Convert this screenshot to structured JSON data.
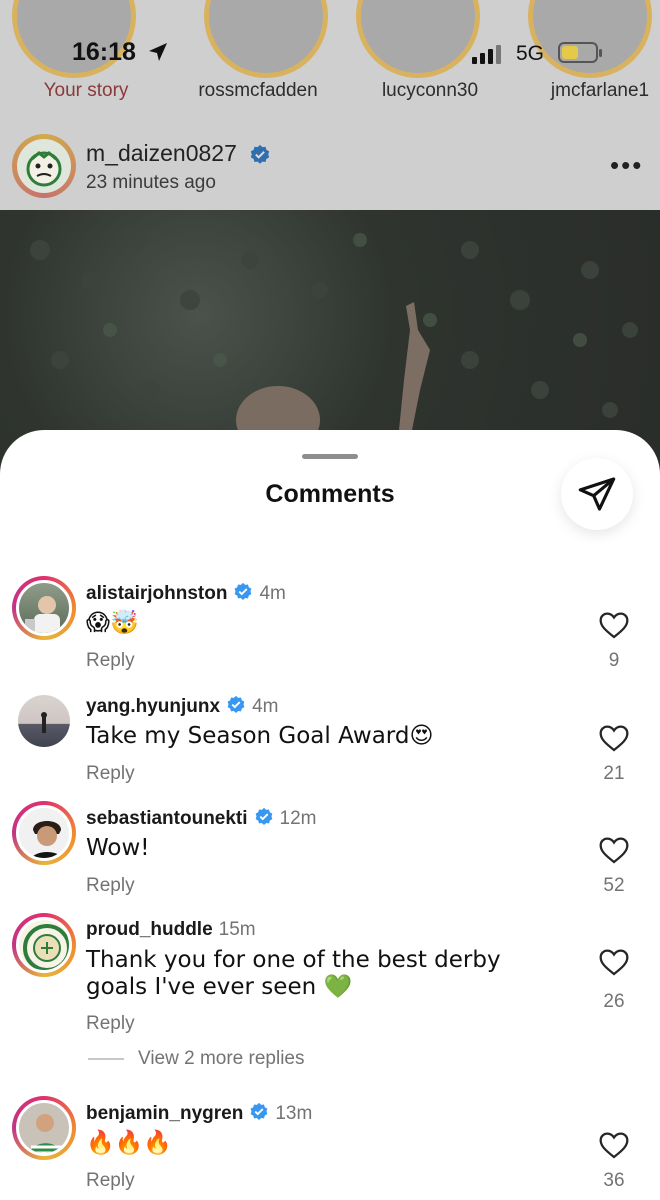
{
  "status_bar": {
    "time": "16:18",
    "network": "5G"
  },
  "stories": [
    {
      "label": "Your story",
      "own": true
    },
    {
      "label": "rossmcfadden"
    },
    {
      "label": "lucyconn30"
    },
    {
      "label": "jmcfarlane1"
    }
  ],
  "post": {
    "username": "m_daizen0827",
    "time_ago": "23 minutes ago",
    "more_label": "•••"
  },
  "sheet": {
    "title": "Comments"
  },
  "comments": [
    {
      "username": "alistairjohnston",
      "verified": true,
      "time": "4m",
      "text": "😱🤯",
      "reply_label": "Reply",
      "likes": "9"
    },
    {
      "username": "yang.hyunjunx",
      "verified": true,
      "time": "4m",
      "text": "Take my Season Goal Award😍",
      "reply_label": "Reply",
      "likes": "21"
    },
    {
      "username": "sebastiantounekti",
      "verified": true,
      "time": "12m",
      "text": "Wow!",
      "reply_label": "Reply",
      "likes": "52"
    },
    {
      "username": "proud_huddle",
      "verified": false,
      "time": "15m",
      "text": "Thank you for one of the best derby goals I've ever seen 💚",
      "reply_label": "Reply",
      "likes": "26"
    },
    {
      "username": "benjamin_nygren",
      "verified": true,
      "time": "13m",
      "text": "🔥🔥🔥",
      "reply_label": "Reply",
      "likes": "36"
    }
  ],
  "view_more_replies": "View 2 more replies",
  "colors": {
    "verified": "#3897f0",
    "like_outline": "#262626",
    "secondary_text": "#737373",
    "story_ring": "#d8b25f"
  },
  "icons": [
    "location-arrow-icon",
    "signal-icon",
    "battery-icon",
    "verified-icon",
    "more-icon",
    "share-icon",
    "heart-icon"
  ]
}
